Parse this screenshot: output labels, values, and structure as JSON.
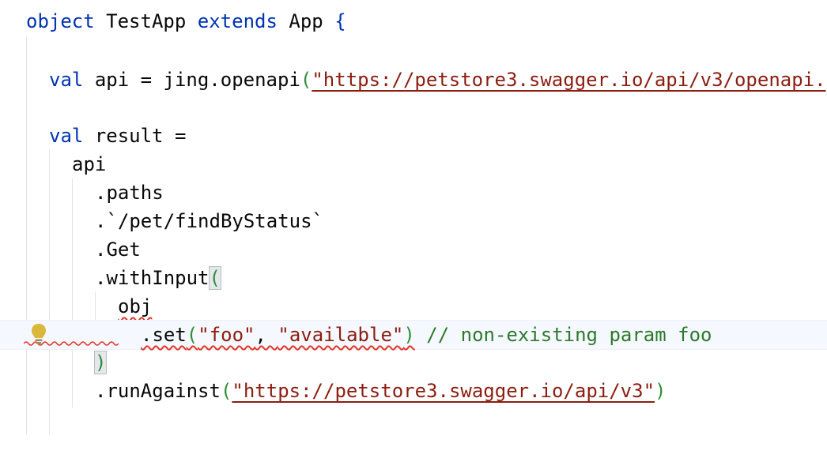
{
  "code": {
    "line1": {
      "kw1": "object",
      "name": "TestApp",
      "kw2": "extends",
      "base": "App",
      "brace": "{"
    },
    "line2": {
      "kw": "val",
      "rest": "api = jing.openapi",
      "open": "(",
      "str": "\"https://petstore3.swagger.io/api/v3/openapi."
    },
    "line3": {
      "kw": "val",
      "rest": "result ="
    },
    "line4": {
      "text": "api"
    },
    "line5": {
      "text": ".paths"
    },
    "line6": {
      "text": ".`/pet/findByStatus`"
    },
    "line7": {
      "text": ".Get"
    },
    "line8": {
      "text": ".withInput",
      "paren": "("
    },
    "line9": {
      "text": "obj"
    },
    "line10": {
      "call": ".set",
      "open": "(",
      "arg1": "\"foo\"",
      "comma": ", ",
      "arg2": "\"available\"",
      "close": ")",
      "comment": "// non-existing param foo"
    },
    "line11": {
      "paren": ")"
    },
    "line12": {
      "call": ".runAgainst",
      "open": "(",
      "str": "\"https://petstore3.swagger.io/api/v3\"",
      "close": ")"
    }
  },
  "colors": {
    "keyword": "#0033b3",
    "string": "#8c1d10",
    "comment": "#2d7a2d",
    "error_wave": "#e0372b",
    "intention_bulb": "#d9b83a"
  },
  "icons": {
    "intention": "lightbulb-icon"
  }
}
